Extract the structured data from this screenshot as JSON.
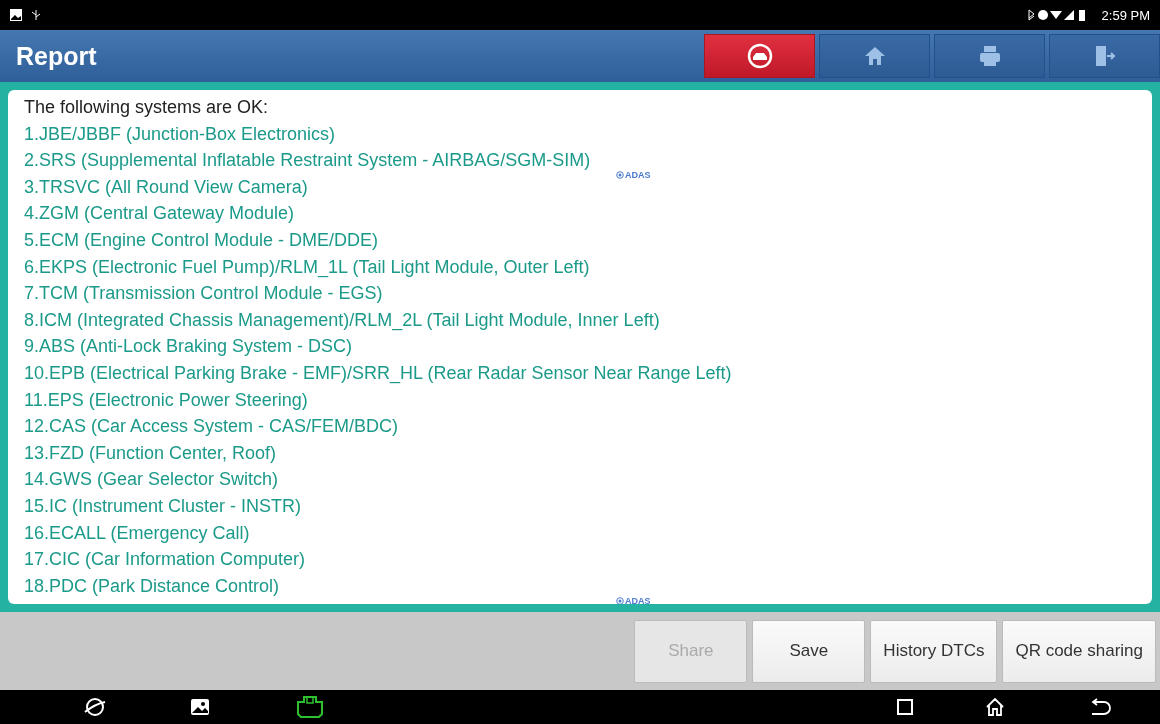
{
  "status_bar": {
    "time": "2:59 PM"
  },
  "header": {
    "title": "Report",
    "buttons": [
      {
        "kind": "car",
        "selected": true
      },
      {
        "kind": "home",
        "selected": false
      },
      {
        "kind": "print",
        "selected": false
      },
      {
        "kind": "exit",
        "selected": false
      }
    ]
  },
  "report": {
    "heading": "The following systems are OK:",
    "items": [
      {
        "text": "1.JBE/JBBF (Junction-Box Electronics)"
      },
      {
        "text": "2.SRS (Supplemental Inflatable Restraint System - AIRBAG/SGM-SIM)",
        "badge": "ADAS"
      },
      {
        "text": "3.TRSVC (All Round View Camera)"
      },
      {
        "text": "4.ZGM (Central Gateway Module)"
      },
      {
        "text": "5.ECM (Engine Control Module - DME/DDE)"
      },
      {
        "text": "6.EKPS (Electronic Fuel Pump)/RLM_1L (Tail Light Module, Outer Left)"
      },
      {
        "text": "7.TCM (Transmission Control Module - EGS)"
      },
      {
        "text": "8.ICM (Integrated Chassis Management)/RLM_2L (Tail Light Module, Inner Left)"
      },
      {
        "text": "9.ABS (Anti-Lock Braking System - DSC)"
      },
      {
        "text": "10.EPB (Electrical Parking Brake - EMF)/SRR_HL (Rear Radar Sensor Near Range Left)"
      },
      {
        "text": "11.EPS (Electronic Power Steering)"
      },
      {
        "text": "12.CAS (Car Access System - CAS/FEM/BDC)"
      },
      {
        "text": "13.FZD (Function Center, Roof)"
      },
      {
        "text": "14.GWS (Gear Selector Switch)"
      },
      {
        "text": "15.IC (Instrument Cluster - INSTR)"
      },
      {
        "text": "16.ECALL (Emergency Call)"
      },
      {
        "text": "17.CIC (Car Information Computer)"
      },
      {
        "text": "18.PDC (Park Distance Control)",
        "badge": "ADAS"
      }
    ]
  },
  "actions": [
    {
      "label": "Share",
      "disabled": true
    },
    {
      "label": "Save",
      "disabled": false
    },
    {
      "label": "History DTCs",
      "disabled": false
    },
    {
      "label": "QR code sharing",
      "disabled": false
    }
  ]
}
